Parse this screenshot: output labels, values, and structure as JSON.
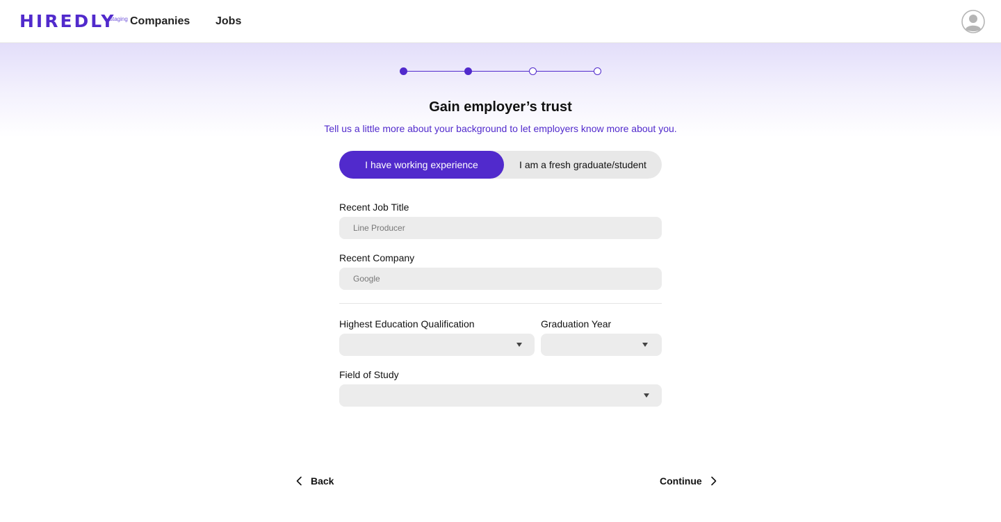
{
  "header": {
    "logo": "HIREDLY",
    "env_badge": "staging",
    "nav": [
      {
        "label": "Companies"
      },
      {
        "label": "Jobs"
      }
    ],
    "avatar_icon": "user-avatar-icon"
  },
  "stepper": {
    "total_steps": 4,
    "completed_steps": 2,
    "accent_color": "#512acc"
  },
  "main": {
    "title": "Gain employer’s trust",
    "subtitle": "Tell us a little more about your background to let employers know more about you."
  },
  "toggle": {
    "options": [
      {
        "label": "I have working experience",
        "selected": true
      },
      {
        "label": "I am a fresh graduate/student",
        "selected": false
      }
    ]
  },
  "form": {
    "job_title": {
      "label": "Recent Job Title",
      "placeholder": "Line Producer",
      "value": ""
    },
    "company": {
      "label": "Recent Company",
      "placeholder": "Google",
      "value": ""
    },
    "education": {
      "label": "Highest Education Qualification",
      "value": ""
    },
    "graduation_year": {
      "label": "Graduation Year",
      "value": ""
    },
    "field_of_study": {
      "label": "Field of Study",
      "value": ""
    }
  },
  "footer": {
    "back_label": "Back",
    "continue_label": "Continue"
  },
  "colors": {
    "brand": "#512acc",
    "field_bg": "#ececec"
  }
}
